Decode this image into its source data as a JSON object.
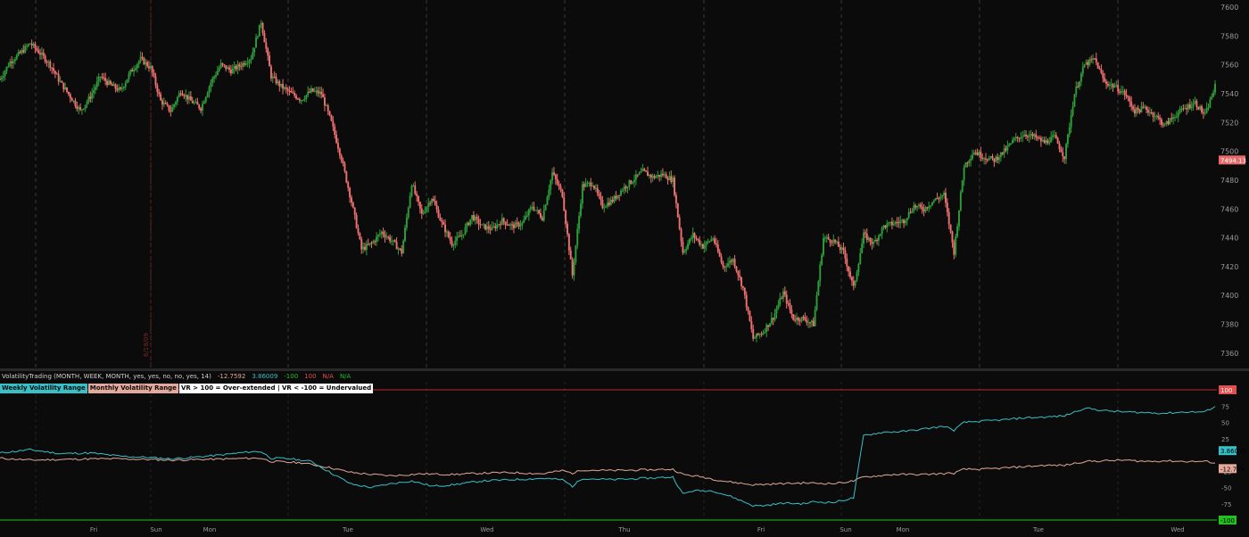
{
  "colors": {
    "background": "#0b0b0b",
    "grid": "#3a3a3a",
    "up_candle": "#2e9e3a",
    "down_candle": "#f07070",
    "weekly_line": "#39bfc6",
    "monthly_line": "#e3a99a",
    "upper_band": "#c0272d",
    "lower_band": "#20c020",
    "axis_text": "#9a9a9a"
  },
  "study": {
    "name": "VolatilityTrading (MONTH, WEEK, MONTH, yes, yes, no, no, yes, 14)",
    "values": [
      "-12.7592",
      "3.86009",
      "-100",
      "100",
      "N/A",
      "N/A"
    ],
    "value_colors": [
      "#e3a99a",
      "#39bfc6",
      "#20c020",
      "#e05050",
      "#e05050",
      "#20c020"
    ]
  },
  "legend": {
    "weekly": "Weekly Volatility Range",
    "monthly": "Monthly Volatility Range",
    "note": "VR > 100 = Over-extended | VR < -100 = Undervalued"
  },
  "side_label": "6/19/09",
  "price_badge": "7494.13",
  "weekly_badge": "3.86009",
  "monthly_badge": "-12.759",
  "upper_badge": "100",
  "lower_badge": "-100",
  "chart_data": [
    {
      "type": "candlestick",
      "title": "",
      "ylim": [
        7350,
        7605
      ],
      "y_ticks": [
        7360,
        7380,
        7400,
        7420,
        7440,
        7460,
        7480,
        7500,
        7520,
        7540,
        7560,
        7580,
        7600
      ],
      "x_labels": [
        "Fri",
        "Sun",
        "Mon",
        "Tue",
        "Wed",
        "Thu",
        "Fri",
        "Sun",
        "Mon",
        "Tue",
        "Wed"
      ],
      "close_points": [
        [
          0,
          7550
        ],
        [
          2,
          7562
        ],
        [
          4,
          7568
        ],
        [
          6,
          7575
        ],
        [
          8,
          7568
        ],
        [
          10,
          7560
        ],
        [
          12,
          7548
        ],
        [
          14,
          7538
        ],
        [
          16,
          7528
        ],
        [
          18,
          7538
        ],
        [
          20,
          7552
        ],
        [
          22,
          7546
        ],
        [
          24,
          7542
        ],
        [
          26,
          7555
        ],
        [
          28,
          7564
        ],
        [
          30,
          7558
        ],
        [
          32,
          7535
        ],
        [
          34,
          7528
        ],
        [
          36,
          7542
        ],
        [
          38,
          7535
        ],
        [
          40,
          7530
        ],
        [
          42,
          7548
        ],
        [
          44,
          7560
        ],
        [
          46,
          7556
        ],
        [
          48,
          7560
        ],
        [
          50,
          7565
        ],
        [
          52,
          7590
        ],
        [
          54,
          7552
        ],
        [
          56,
          7545
        ],
        [
          58,
          7540
        ],
        [
          60,
          7536
        ],
        [
          62,
          7542
        ],
        [
          64,
          7540
        ],
        [
          66,
          7520
        ],
        [
          68,
          7495
        ],
        [
          70,
          7465
        ],
        [
          72,
          7432
        ],
        [
          74,
          7436
        ],
        [
          76,
          7444
        ],
        [
          78,
          7438
        ],
        [
          80,
          7430
        ],
        [
          82,
          7478
        ],
        [
          84,
          7456
        ],
        [
          86,
          7468
        ],
        [
          88,
          7450
        ],
        [
          90,
          7436
        ],
        [
          92,
          7442
        ],
        [
          94,
          7455
        ],
        [
          96,
          7448
        ],
        [
          98,
          7446
        ],
        [
          100,
          7452
        ],
        [
          102,
          7448
        ],
        [
          104,
          7450
        ],
        [
          106,
          7462
        ],
        [
          108,
          7454
        ],
        [
          110,
          7485
        ],
        [
          112,
          7470
        ],
        [
          114,
          7414
        ],
        [
          116,
          7476
        ],
        [
          118,
          7478
        ],
        [
          120,
          7462
        ],
        [
          122,
          7466
        ],
        [
          124,
          7474
        ],
        [
          126,
          7480
        ],
        [
          128,
          7486
        ],
        [
          130,
          7482
        ],
        [
          132,
          7484
        ],
        [
          134,
          7480
        ],
        [
          136,
          7430
        ],
        [
          138,
          7442
        ],
        [
          140,
          7434
        ],
        [
          142,
          7440
        ],
        [
          144,
          7420
        ],
        [
          146,
          7425
        ],
        [
          148,
          7405
        ],
        [
          150,
          7370
        ],
        [
          152,
          7375
        ],
        [
          154,
          7385
        ],
        [
          156,
          7402
        ],
        [
          158,
          7384
        ],
        [
          160,
          7384
        ],
        [
          162,
          7380
        ],
        [
          164,
          7440
        ],
        [
          166,
          7438
        ],
        [
          168,
          7430
        ],
        [
          170,
          7405
        ],
        [
          172,
          7442
        ],
        [
          174,
          7436
        ],
        [
          176,
          7448
        ],
        [
          178,
          7450
        ],
        [
          180,
          7452
        ],
        [
          182,
          7462
        ],
        [
          184,
          7460
        ],
        [
          186,
          7466
        ],
        [
          188,
          7470
        ],
        [
          190,
          7430
        ],
        [
          192,
          7490
        ],
        [
          194,
          7500
        ],
        [
          196,
          7496
        ],
        [
          198,
          7494
        ],
        [
          200,
          7500
        ],
        [
          202,
          7508
        ],
        [
          204,
          7512
        ],
        [
          206,
          7510
        ],
        [
          208,
          7506
        ],
        [
          210,
          7510
        ],
        [
          212,
          7496
        ],
        [
          214,
          7540
        ],
        [
          216,
          7560
        ],
        [
          218,
          7564
        ],
        [
          220,
          7548
        ],
        [
          222,
          7545
        ],
        [
          224,
          7540
        ],
        [
          226,
          7528
        ],
        [
          228,
          7530
        ],
        [
          230,
          7525
        ],
        [
          232,
          7518
        ],
        [
          234,
          7525
        ],
        [
          236,
          7530
        ],
        [
          238,
          7534
        ],
        [
          240,
          7525
        ],
        [
          242,
          7545
        ]
      ]
    },
    {
      "type": "line",
      "title": "",
      "ylim": [
        -100,
        100
      ],
      "y_ticks": [
        -100,
        -75,
        -50,
        -25,
        0,
        25,
        50,
        75,
        100
      ],
      "series": [
        {
          "name": "Weekly Volatility Range",
          "points": [
            [
              0,
              3
            ],
            [
              6,
              8
            ],
            [
              12,
              2
            ],
            [
              18,
              3
            ],
            [
              24,
              -2
            ],
            [
              30,
              -4
            ],
            [
              34,
              -6
            ],
            [
              38,
              -4
            ],
            [
              44,
              0
            ],
            [
              50,
              5
            ],
            [
              52,
              5
            ],
            [
              54,
              -5
            ],
            [
              58,
              -6
            ],
            [
              62,
              -10
            ],
            [
              66,
              -28
            ],
            [
              70,
              -45
            ],
            [
              74,
              -50
            ],
            [
              78,
              -44
            ],
            [
              82,
              -40
            ],
            [
              86,
              -48
            ],
            [
              90,
              -46
            ],
            [
              96,
              -40
            ],
            [
              102,
              -38
            ],
            [
              108,
              -36
            ],
            [
              112,
              -38
            ],
            [
              114,
              -48
            ],
            [
              116,
              -36
            ],
            [
              122,
              -38
            ],
            [
              128,
              -36
            ],
            [
              134,
              -34
            ],
            [
              136,
              -60
            ],
            [
              138,
              -55
            ],
            [
              142,
              -55
            ],
            [
              146,
              -65
            ],
            [
              150,
              -78
            ],
            [
              152,
              -78
            ],
            [
              156,
              -74
            ],
            [
              160,
              -75
            ],
            [
              162,
              -72
            ],
            [
              166,
              -73
            ],
            [
              170,
              -66
            ],
            [
              172,
              30
            ],
            [
              176,
              35
            ],
            [
              180,
              36
            ],
            [
              184,
              40
            ],
            [
              188,
              44
            ],
            [
              190,
              38
            ],
            [
              192,
              50
            ],
            [
              196,
              52
            ],
            [
              200,
              54
            ],
            [
              204,
              57
            ],
            [
              208,
              58
            ],
            [
              212,
              60
            ],
            [
              216,
              72
            ],
            [
              220,
              68
            ],
            [
              224,
              66
            ],
            [
              228,
              65
            ],
            [
              232,
              64
            ],
            [
              236,
              66
            ],
            [
              240,
              66
            ],
            [
              242,
              75
            ]
          ]
        },
        {
          "name": "Monthly Volatility Range",
          "points": [
            [
              0,
              -5
            ],
            [
              6,
              -8
            ],
            [
              12,
              -7
            ],
            [
              18,
              -6
            ],
            [
              24,
              -6
            ],
            [
              30,
              -7
            ],
            [
              34,
              -8
            ],
            [
              40,
              -7
            ],
            [
              46,
              -6
            ],
            [
              50,
              -5
            ],
            [
              52,
              -5
            ],
            [
              54,
              -10
            ],
            [
              60,
              -12
            ],
            [
              66,
              -20
            ],
            [
              70,
              -27
            ],
            [
              74,
              -30
            ],
            [
              78,
              -32
            ],
            [
              84,
              -29
            ],
            [
              90,
              -30
            ],
            [
              96,
              -28
            ],
            [
              102,
              -27
            ],
            [
              108,
              -29
            ],
            [
              112,
              -24
            ],
            [
              114,
              -28
            ],
            [
              116,
              -23
            ],
            [
              122,
              -24
            ],
            [
              128,
              -23
            ],
            [
              134,
              -22
            ],
            [
              136,
              -30
            ],
            [
              140,
              -34
            ],
            [
              144,
              -40
            ],
            [
              150,
              -46
            ],
            [
              156,
              -44
            ],
            [
              160,
              -43
            ],
            [
              166,
              -44
            ],
            [
              170,
              -40
            ],
            [
              172,
              -34
            ],
            [
              178,
              -30
            ],
            [
              184,
              -30
            ],
            [
              190,
              -28
            ],
            [
              192,
              -22
            ],
            [
              196,
              -22
            ],
            [
              200,
              -20
            ],
            [
              204,
              -18
            ],
            [
              208,
              -16
            ],
            [
              212,
              -16
            ],
            [
              216,
              -10
            ],
            [
              220,
              -9
            ],
            [
              224,
              -8
            ],
            [
              228,
              -10
            ],
            [
              232,
              -9
            ],
            [
              236,
              -10
            ],
            [
              240,
              -10
            ],
            [
              242,
              -12
            ]
          ]
        }
      ]
    }
  ]
}
